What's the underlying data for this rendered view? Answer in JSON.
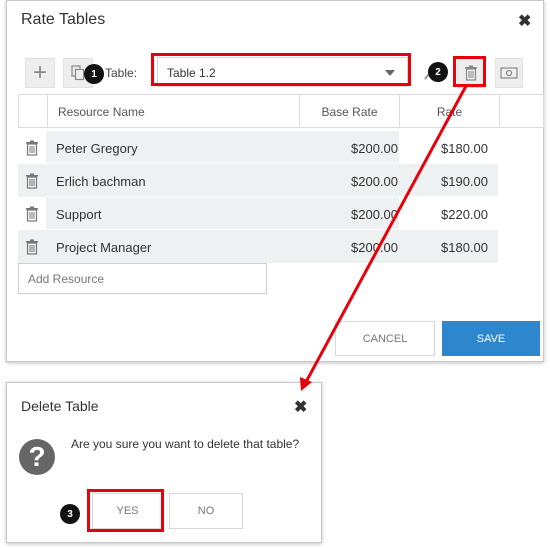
{
  "rate_dialog": {
    "title": "Rate Tables",
    "table_label": "Table:",
    "selected_table": "Table 1.2",
    "columns": [
      "Resource Name",
      "Base Rate",
      "Rate"
    ],
    "rows": [
      {
        "name": "Peter Gregory",
        "base_rate": "$200.00",
        "rate": "$180.00"
      },
      {
        "name": "Erlich bachman",
        "base_rate": "$200.00",
        "rate": "$190.00"
      },
      {
        "name": "Support",
        "base_rate": "$200.00",
        "rate": "$220.00"
      },
      {
        "name": "Project Manager",
        "base_rate": "$200.00",
        "rate": "$180.00"
      }
    ],
    "add_resource_placeholder": "Add Resource",
    "cancel_label": "CANCEL",
    "save_label": "SAVE"
  },
  "delete_dialog": {
    "title": "Delete Table",
    "message": "Are you sure you want to delete that table?",
    "yes_label": "YES",
    "no_label": "NO"
  },
  "callouts": [
    "1",
    "2",
    "3"
  ],
  "colors": {
    "highlight": "#e8000b",
    "save_button": "#2e86cd",
    "row_shade": "#eef1f1"
  },
  "icons": [
    "plus-icon",
    "copy-icon",
    "trash-icon",
    "money-icon",
    "close-icon",
    "question-icon",
    "chevron-down-icon"
  ]
}
